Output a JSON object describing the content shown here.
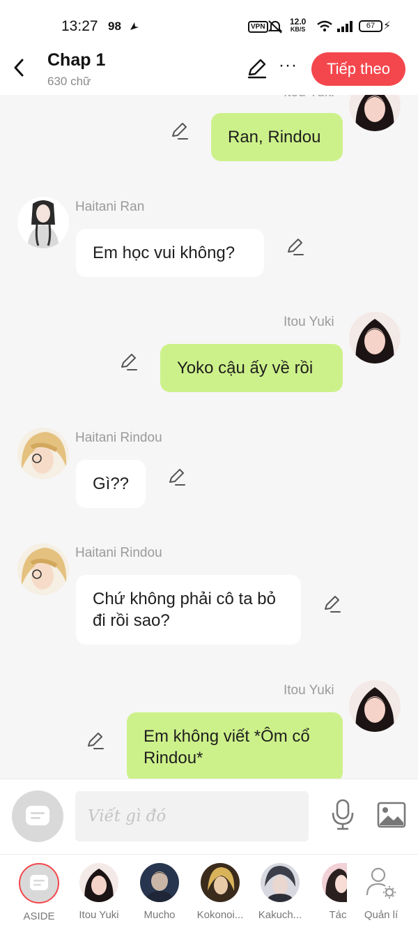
{
  "status_bar": {
    "time": "13:27",
    "notif_count": "98",
    "vpn": "VPN",
    "speed_top": "12.0",
    "speed_bottom": "KB/S",
    "battery": "67"
  },
  "header": {
    "title": "Chap 1",
    "subtitle": "630 chữ",
    "next_label": "Tiếp theo",
    "more_label": "···"
  },
  "chat": {
    "messages": [
      {
        "side": "right",
        "name": "Itou Yuki",
        "text": "Ran, Rindou"
      },
      {
        "side": "left",
        "name": "Haitani Ran",
        "text": "Em học vui không?"
      },
      {
        "side": "right",
        "name": "Itou Yuki",
        "text": "Yoko cậu ấy về rồi"
      },
      {
        "side": "left",
        "name": "Haitani Rindou",
        "text": "Gì??"
      },
      {
        "side": "left",
        "name": "Haitani Rindou",
        "text": "Chứ không phải cô ta bỏ  đi rồi sao?"
      },
      {
        "side": "right",
        "name": "Itou Yuki",
        "text": "Em không viết *Ôm cổ Rindou*"
      }
    ]
  },
  "input": {
    "placeholder": "Viết gì đó"
  },
  "bottom_nav": {
    "items": [
      {
        "label": "ASIDE"
      },
      {
        "label": "Itou Yuki"
      },
      {
        "label": "Mucho"
      },
      {
        "label": "Kokonoi..."
      },
      {
        "label": "Kakuch..."
      },
      {
        "label": "Tác"
      },
      {
        "label": "Quản lí"
      }
    ]
  },
  "colors": {
    "accent": "#f4474d",
    "bubble_right": "#cdf18a",
    "bubble_left": "#ffffff",
    "background": "#f6f6f6"
  }
}
